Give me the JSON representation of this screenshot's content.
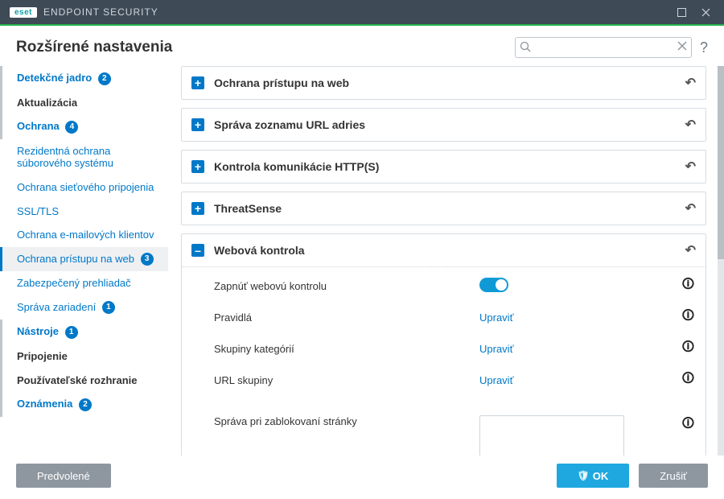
{
  "titlebar": {
    "logo": "eset",
    "product": "ENDPOINT SECURITY"
  },
  "header": {
    "title": "Rozšírené nastavenia",
    "search_placeholder": ""
  },
  "sidebar": {
    "items": [
      {
        "label": "Detekčné jadro",
        "badge": "2",
        "type": "top",
        "blue": true
      },
      {
        "label": "Aktualizácia",
        "type": "top"
      },
      {
        "label": "Ochrana",
        "badge": "4",
        "type": "top",
        "blue": true
      },
      {
        "label": "Rezidentná ochrana súborového systému",
        "type": "sub",
        "blue": true
      },
      {
        "label": "Ochrana sieťového pripojenia",
        "type": "sub",
        "blue": true
      },
      {
        "label": "SSL/TLS",
        "type": "sub",
        "blue": true
      },
      {
        "label": "Ochrana e-mailových klientov",
        "type": "sub",
        "blue": true
      },
      {
        "label": "Ochrana prístupu na web",
        "badge": "3",
        "type": "sub",
        "blue": true,
        "active": true
      },
      {
        "label": "Zabezpečený prehliadač",
        "type": "sub",
        "blue": true
      },
      {
        "label": "Správa zariadení",
        "badge": "1",
        "type": "sub",
        "blue": true
      },
      {
        "label": "Nástroje",
        "badge": "1",
        "type": "top",
        "blue": true
      },
      {
        "label": "Pripojenie",
        "type": "top"
      },
      {
        "label": "Používateľské rozhranie",
        "type": "top"
      },
      {
        "label": "Oznámenia",
        "badge": "2",
        "type": "top",
        "blue": true
      }
    ]
  },
  "sections": [
    {
      "title": "Ochrana prístupu na web",
      "expanded": false
    },
    {
      "title": "Správa zoznamu URL adries",
      "expanded": false
    },
    {
      "title": "Kontrola komunikácie HTTP(S)",
      "expanded": false
    },
    {
      "title": "ThreatSense",
      "expanded": false
    },
    {
      "title": "Webová kontrola",
      "expanded": true
    }
  ],
  "webcontrol": {
    "rows": [
      {
        "label": "Zapnúť webovú kontrolu",
        "type": "toggle",
        "on": true
      },
      {
        "label": "Pravidlá",
        "type": "link",
        "action": "Upraviť"
      },
      {
        "label": "Skupiny kategórií",
        "type": "link",
        "action": "Upraviť"
      },
      {
        "label": "URL skupiny",
        "type": "link",
        "action": "Upraviť"
      }
    ],
    "message_label": "Správa pri zablokovaní stránky",
    "message_value": ""
  },
  "footer": {
    "default_btn": "Predvolené",
    "ok_btn": "OK",
    "cancel_btn": "Zrušiť"
  }
}
